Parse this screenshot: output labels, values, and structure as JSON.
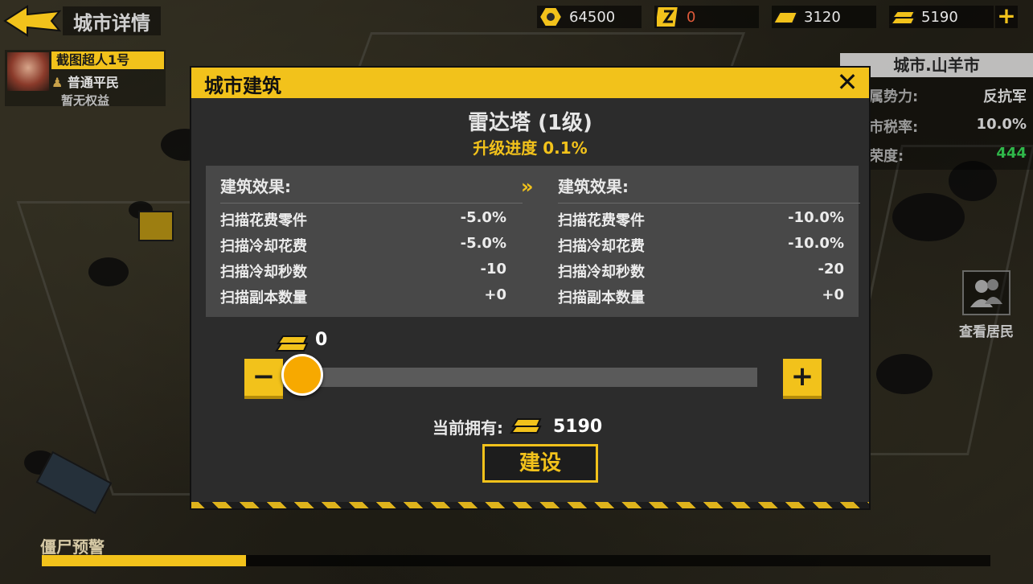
{
  "top": {
    "title": "城市详情",
    "resources": [
      {
        "icon": "nut-icon",
        "value": "64500",
        "color": "#e6e6e6"
      },
      {
        "icon": "energy-icon",
        "value": "0",
        "color": "#e05a3a"
      },
      {
        "icon": "gold-ingot-icon",
        "value": "3120",
        "color": "#e6e6e6"
      },
      {
        "icon": "gold-bars-icon",
        "value": "5190",
        "color": "#e6e6e6"
      }
    ],
    "add_label": "+"
  },
  "player": {
    "name": "截图超人1号",
    "rank": "普通平民",
    "rights": "暂无权益"
  },
  "city": {
    "name": "城市.山羊市",
    "rows": [
      {
        "key": "属势力:",
        "value": "反抗军"
      },
      {
        "key": "市税率:",
        "value": "10.0%"
      },
      {
        "key": "荣度:",
        "value": "444"
      }
    ],
    "residents_label": "查看居民"
  },
  "zombie_warning": {
    "label": "僵尸预警",
    "progress": 0.215
  },
  "modal": {
    "title": "城市建筑",
    "close_label": "✕",
    "building_name": "雷达塔 (1级)",
    "upgrade_label": "升级进度",
    "upgrade_value": "0.1%",
    "effects": {
      "current": {
        "header": "建筑效果:",
        "rows": [
          {
            "name": "扫描花费零件",
            "value": "-5.0%"
          },
          {
            "name": "扫描冷却花费",
            "value": "-5.0%"
          },
          {
            "name": "扫描冷却秒数",
            "value": "-10"
          },
          {
            "name": "扫描副本数量",
            "value": "+0"
          }
        ]
      },
      "arrow": "»",
      "next": {
        "header": "建筑效果:",
        "rows": [
          {
            "name": "扫描花费零件",
            "value": "-10.0%"
          },
          {
            "name": "扫描冷却花费",
            "value": "-10.0%"
          },
          {
            "name": "扫描冷却秒数",
            "value": "-20"
          },
          {
            "name": "扫描副本数量",
            "value": "+0"
          }
        ]
      }
    },
    "amount": "0",
    "slider_fraction": 0,
    "minus_label": "−",
    "plus_label": "+",
    "own_label": "当前拥有:",
    "own_value": "5190",
    "build_label": "建设"
  },
  "colors": {
    "accent": "#f2c21b",
    "panel": "#2c2c2c"
  }
}
